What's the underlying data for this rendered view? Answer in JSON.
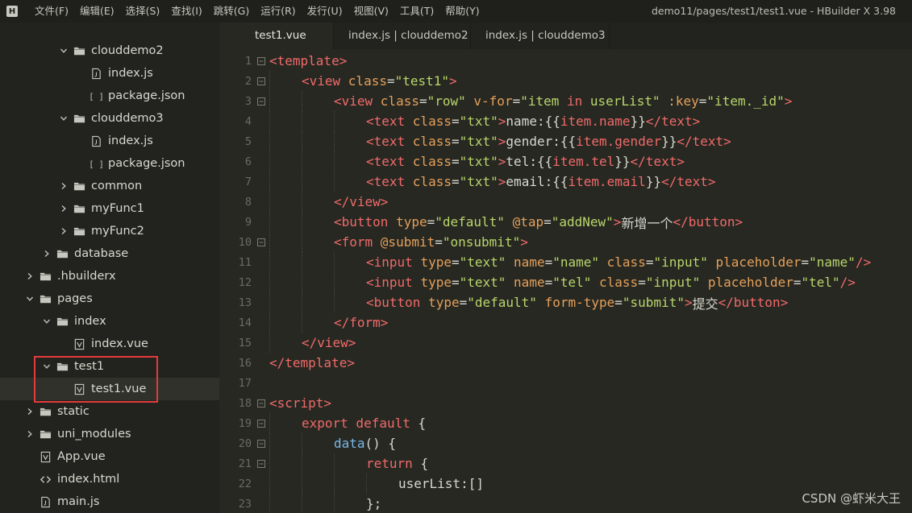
{
  "titlebar": {
    "menu": [
      "文件(F)",
      "编辑(E)",
      "选择(S)",
      "查找(I)",
      "跳转(G)",
      "运行(R)",
      "发行(U)",
      "视图(V)",
      "工具(T)",
      "帮助(Y)"
    ],
    "window_title": "demo11/pages/test1/test1.vue - HBuilder X 3.98"
  },
  "sidebar": {
    "items": [
      {
        "label": "clouddemo2",
        "type": "folder",
        "expanded": true
      },
      {
        "label": "index.js",
        "type": "file-js"
      },
      {
        "label": "package.json",
        "type": "file-json"
      },
      {
        "label": "clouddemo3",
        "type": "folder",
        "expanded": true
      },
      {
        "label": "index.js",
        "type": "file-js"
      },
      {
        "label": "package.json",
        "type": "file-json"
      },
      {
        "label": "common",
        "type": "folder",
        "expanded": false
      },
      {
        "label": "myFunc1",
        "type": "folder",
        "expanded": false
      },
      {
        "label": "myFunc2",
        "type": "folder",
        "expanded": false
      },
      {
        "label": "database",
        "type": "folder",
        "expanded": false
      },
      {
        "label": ".hbuilderx",
        "type": "folder",
        "expanded": false
      },
      {
        "label": "pages",
        "type": "folder",
        "expanded": true
      },
      {
        "label": "index",
        "type": "folder",
        "expanded": true
      },
      {
        "label": "index.vue",
        "type": "file-vue"
      },
      {
        "label": "test1",
        "type": "folder",
        "expanded": true
      },
      {
        "label": "test1.vue",
        "type": "file-vue"
      },
      {
        "label": "static",
        "type": "folder",
        "expanded": false
      },
      {
        "label": "uni_modules",
        "type": "folder",
        "expanded": false
      },
      {
        "label": "App.vue",
        "type": "file-vue"
      },
      {
        "label": "index.html",
        "type": "file-html"
      },
      {
        "label": "main.js",
        "type": "file-js"
      }
    ]
  },
  "tabs": [
    "test1.vue",
    "index.js | clouddemo2",
    "index.js | clouddemo3"
  ],
  "code": {
    "line_numbers": [
      "1",
      "2",
      "3",
      "4",
      "5",
      "6",
      "7",
      "8",
      "9",
      "10",
      "11",
      "12",
      "13",
      "14",
      "15",
      "16",
      "17",
      "18",
      "19",
      "20",
      "21",
      "22",
      "23"
    ],
    "lines": [
      [
        {
          "c": "tag",
          "t": "<template>"
        }
      ],
      [
        {
          "c": "tag",
          "t": "<view "
        },
        {
          "c": "attr",
          "t": "class"
        },
        {
          "c": "punc",
          "t": "="
        },
        {
          "c": "str",
          "t": "\"test1\""
        },
        {
          "c": "tag",
          "t": ">"
        }
      ],
      [
        {
          "c": "tag",
          "t": "<view "
        },
        {
          "c": "attr",
          "t": "class"
        },
        {
          "c": "punc",
          "t": "="
        },
        {
          "c": "str",
          "t": "\"row\" "
        },
        {
          "c": "attr",
          "t": "v-for"
        },
        {
          "c": "punc",
          "t": "="
        },
        {
          "c": "str",
          "t": "\"item "
        },
        {
          "c": "kw",
          "t": "in"
        },
        {
          "c": "str",
          "t": " userList\" "
        },
        {
          "c": "attr",
          "t": ":key"
        },
        {
          "c": "punc",
          "t": "="
        },
        {
          "c": "str",
          "t": "\"item._id\""
        },
        {
          "c": "tag",
          "t": ">"
        }
      ],
      [
        {
          "c": "tag",
          "t": "<text "
        },
        {
          "c": "attr",
          "t": "class"
        },
        {
          "c": "punc",
          "t": "="
        },
        {
          "c": "str",
          "t": "\"txt\""
        },
        {
          "c": "tag",
          "t": ">"
        },
        {
          "c": "text",
          "t": "name:{{"
        },
        {
          "c": "tag",
          "t": "item.name"
        },
        {
          "c": "text",
          "t": "}}"
        },
        {
          "c": "tag",
          "t": "</text>"
        }
      ],
      [
        {
          "c": "tag",
          "t": "<text "
        },
        {
          "c": "attr",
          "t": "class"
        },
        {
          "c": "punc",
          "t": "="
        },
        {
          "c": "str",
          "t": "\"txt\""
        },
        {
          "c": "tag",
          "t": ">"
        },
        {
          "c": "text",
          "t": "gender:{{"
        },
        {
          "c": "tag",
          "t": "item.gender"
        },
        {
          "c": "text",
          "t": "}}"
        },
        {
          "c": "tag",
          "t": "</text>"
        }
      ],
      [
        {
          "c": "tag",
          "t": "<text "
        },
        {
          "c": "attr",
          "t": "class"
        },
        {
          "c": "punc",
          "t": "="
        },
        {
          "c": "str",
          "t": "\"txt\""
        },
        {
          "c": "tag",
          "t": ">"
        },
        {
          "c": "text",
          "t": "tel:{{"
        },
        {
          "c": "tag",
          "t": "item.tel"
        },
        {
          "c": "text",
          "t": "}}"
        },
        {
          "c": "tag",
          "t": "</text>"
        }
      ],
      [
        {
          "c": "tag",
          "t": "<text "
        },
        {
          "c": "attr",
          "t": "class"
        },
        {
          "c": "punc",
          "t": "="
        },
        {
          "c": "str",
          "t": "\"txt\""
        },
        {
          "c": "tag",
          "t": ">"
        },
        {
          "c": "text",
          "t": "email:{{"
        },
        {
          "c": "tag",
          "t": "item.email"
        },
        {
          "c": "text",
          "t": "}}"
        },
        {
          "c": "tag",
          "t": "</text>"
        }
      ],
      [
        {
          "c": "tag",
          "t": "</view>"
        }
      ],
      [
        {
          "c": "tag",
          "t": "<button "
        },
        {
          "c": "attr",
          "t": "type"
        },
        {
          "c": "punc",
          "t": "="
        },
        {
          "c": "str",
          "t": "\"default\" "
        },
        {
          "c": "attr",
          "t": "@tap"
        },
        {
          "c": "punc",
          "t": "="
        },
        {
          "c": "str",
          "t": "\"addNew\""
        },
        {
          "c": "tag",
          "t": ">"
        },
        {
          "c": "text",
          "t": "新增一个"
        },
        {
          "c": "tag",
          "t": "</button>"
        }
      ],
      [
        {
          "c": "tag",
          "t": "<form "
        },
        {
          "c": "attr",
          "t": "@submit"
        },
        {
          "c": "punc",
          "t": "="
        },
        {
          "c": "str",
          "t": "\"onsubmit\""
        },
        {
          "c": "tag",
          "t": ">"
        }
      ],
      [
        {
          "c": "tag",
          "t": "<input "
        },
        {
          "c": "attr",
          "t": "type"
        },
        {
          "c": "punc",
          "t": "="
        },
        {
          "c": "str",
          "t": "\"text\" "
        },
        {
          "c": "attr",
          "t": "name"
        },
        {
          "c": "punc",
          "t": "="
        },
        {
          "c": "str",
          "t": "\"name\" "
        },
        {
          "c": "attr",
          "t": "class"
        },
        {
          "c": "punc",
          "t": "="
        },
        {
          "c": "str",
          "t": "\"input\" "
        },
        {
          "c": "attr",
          "t": "placeholder"
        },
        {
          "c": "punc",
          "t": "="
        },
        {
          "c": "str",
          "t": "\"name\""
        },
        {
          "c": "tag",
          "t": "/>"
        }
      ],
      [
        {
          "c": "tag",
          "t": "<input "
        },
        {
          "c": "attr",
          "t": "type"
        },
        {
          "c": "punc",
          "t": "="
        },
        {
          "c": "str",
          "t": "\"text\" "
        },
        {
          "c": "attr",
          "t": "name"
        },
        {
          "c": "punc",
          "t": "="
        },
        {
          "c": "str",
          "t": "\"tel\" "
        },
        {
          "c": "attr",
          "t": "class"
        },
        {
          "c": "punc",
          "t": "="
        },
        {
          "c": "str",
          "t": "\"input\" "
        },
        {
          "c": "attr",
          "t": "placeholder"
        },
        {
          "c": "punc",
          "t": "="
        },
        {
          "c": "str",
          "t": "\"tel\""
        },
        {
          "c": "tag",
          "t": "/>"
        }
      ],
      [
        {
          "c": "tag",
          "t": "<button "
        },
        {
          "c": "attr",
          "t": "type"
        },
        {
          "c": "punc",
          "t": "="
        },
        {
          "c": "str",
          "t": "\"default\" "
        },
        {
          "c": "attr",
          "t": "form-type"
        },
        {
          "c": "punc",
          "t": "="
        },
        {
          "c": "str",
          "t": "\"submit\""
        },
        {
          "c": "tag",
          "t": ">"
        },
        {
          "c": "text",
          "t": "提交"
        },
        {
          "c": "tag",
          "t": "</button>"
        }
      ],
      [
        {
          "c": "tag",
          "t": "</form>"
        }
      ],
      [
        {
          "c": "tag",
          "t": "</view>"
        }
      ],
      [
        {
          "c": "tag",
          "t": "</template>"
        }
      ],
      [],
      [
        {
          "c": "tag",
          "t": "<script>"
        }
      ],
      [
        {
          "c": "kw",
          "t": "export default "
        },
        {
          "c": "punc",
          "t": "{"
        }
      ],
      [
        {
          "c": "fn",
          "t": "data"
        },
        {
          "c": "punc",
          "t": "() {"
        }
      ],
      [
        {
          "c": "kw",
          "t": "return "
        },
        {
          "c": "punc",
          "t": "{"
        }
      ],
      [
        {
          "c": "var",
          "t": "userList:[]"
        }
      ],
      [
        {
          "c": "punc",
          "t": "};"
        }
      ]
    ]
  },
  "watermark": "CSDN @虾米大王"
}
